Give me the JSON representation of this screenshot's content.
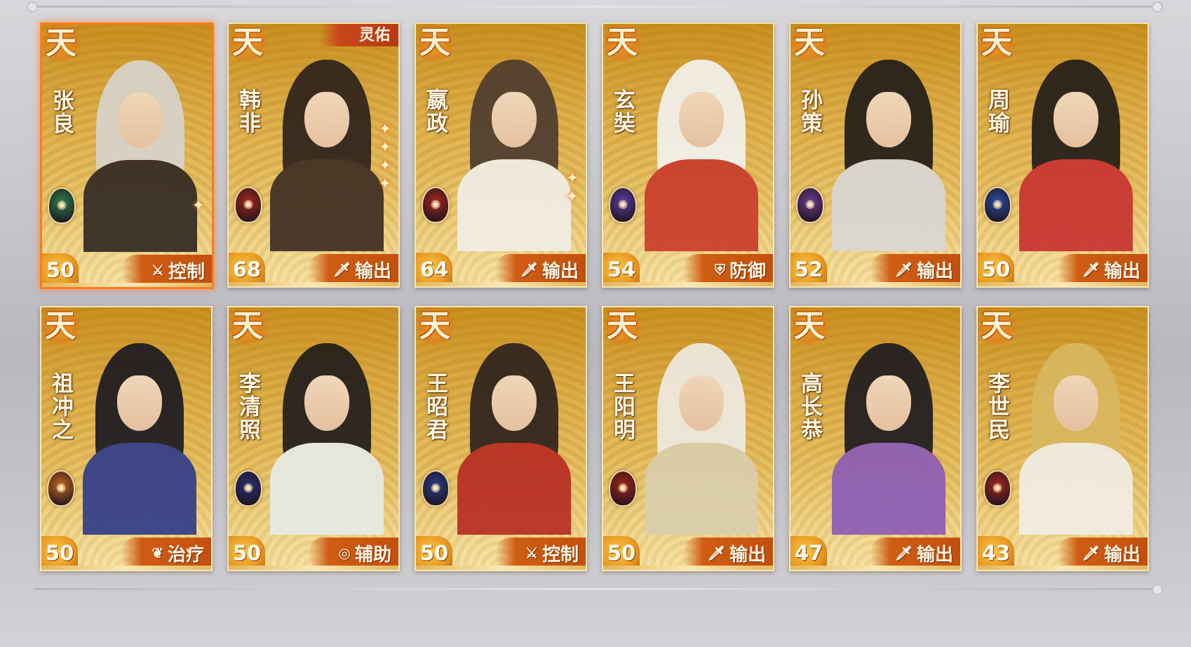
{
  "heroes": [
    {
      "name": "张良",
      "level": "50",
      "role": "控制",
      "role_icon": "crossed-swords-icon",
      "tier": "天",
      "selected": true,
      "stars": 1,
      "badge": "",
      "emblem": "green-jade-emblem",
      "emblem_color": "#2d7d4a",
      "hair": "#d7d5cf",
      "robe": "#2e2622"
    },
    {
      "name": "韩非",
      "level": "68",
      "role": "输出",
      "role_icon": "sword-icon",
      "tier": "天",
      "selected": false,
      "stars": 4,
      "badge": "灵佑",
      "emblem": "red-dragon-emblem",
      "emblem_color": "#a3261c",
      "hair": "#2a1f1a",
      "robe": "#3b2b22"
    },
    {
      "name": "嬴政",
      "level": "64",
      "role": "输出",
      "role_icon": "sword-icon",
      "tier": "天",
      "selected": false,
      "stars": 2,
      "badge": "",
      "emblem": "red-dragon-emblem",
      "emblem_color": "#a3261c",
      "hair": "#4a3a2f",
      "robe": "#f2efe9"
    },
    {
      "name": "玄奘",
      "level": "54",
      "role": "防御",
      "role_icon": "shield-icon",
      "tier": "天",
      "selected": false,
      "stars": 0,
      "badge": "",
      "emblem": "purple-wheel-emblem",
      "emblem_color": "#5a3a9c",
      "hair": "#f4f4f2",
      "robe": "#c93a2a"
    },
    {
      "name": "孙策",
      "level": "52",
      "role": "输出",
      "role_icon": "sword-icon",
      "tier": "天",
      "selected": false,
      "stars": 0,
      "badge": "",
      "emblem": "purple-heart-emblem",
      "emblem_color": "#6a3a8c",
      "hair": "#1e1a18",
      "robe": "#d9d8d6"
    },
    {
      "name": "周瑜",
      "level": "50",
      "role": "输出",
      "role_icon": "sword-icon",
      "tier": "天",
      "selected": false,
      "stars": 0,
      "badge": "",
      "emblem": "blue-phoenix-emblem",
      "emblem_color": "#2a4a9c",
      "hair": "#1f1a18",
      "robe": "#c83030"
    },
    {
      "name": "祖冲之",
      "level": "50",
      "role": "治疗",
      "role_icon": "sprout-icon",
      "tier": "天",
      "selected": false,
      "stars": 0,
      "badge": "",
      "emblem": "orange-compass-emblem",
      "emblem_color": "#c2661e",
      "hair": "#171720",
      "robe": "#2e3a8a"
    },
    {
      "name": "李清照",
      "level": "50",
      "role": "辅助",
      "role_icon": "swirl-icon",
      "tier": "天",
      "selected": false,
      "stars": 0,
      "badge": "",
      "emblem": "blue-night-emblem",
      "emblem_color": "#2a3070",
      "hair": "#1c1a1a",
      "robe": "#e8ecea"
    },
    {
      "name": "王昭君",
      "level": "50",
      "role": "控制",
      "role_icon": "crossed-swords-icon",
      "tier": "天",
      "selected": false,
      "stars": 0,
      "badge": "",
      "emblem": "blue-phoenix-emblem",
      "emblem_color": "#2a3a80",
      "hair": "#2a1f1c",
      "robe": "#b72a22"
    },
    {
      "name": "王阳明",
      "level": "50",
      "role": "输出",
      "role_icon": "sword-icon",
      "tier": "天",
      "selected": false,
      "stars": 0,
      "badge": "",
      "emblem": "red-dragon-emblem",
      "emblem_color": "#a3261c",
      "hair": "#efece6",
      "robe": "#d9cfae"
    },
    {
      "name": "高长恭",
      "level": "47",
      "role": "输出",
      "role_icon": "sword-icon",
      "tier": "天",
      "selected": false,
      "stars": 0,
      "badge": "",
      "emblem": "",
      "emblem_color": "",
      "hair": "#1a1820",
      "robe": "#8a5ab8"
    },
    {
      "name": "李世民",
      "level": "43",
      "role": "输出",
      "role_icon": "sword-icon",
      "tier": "天",
      "selected": false,
      "stars": 0,
      "badge": "",
      "emblem": "red-dragon-emblem",
      "emblem_color": "#a3261c",
      "hair": "#d8b860",
      "robe": "#f2efe8"
    }
  ],
  "role_glyphs": {
    "crossed-swords-icon": "⚔",
    "sword-icon": "🗡",
    "shield-icon": "⛨",
    "sprout-icon": "❦",
    "swirl-icon": "◎"
  },
  "star_glyph": "✦",
  "colors": {
    "accent": "#ff7a1c",
    "card_gold": "#deb04a",
    "role_bar": "#c3500d"
  }
}
